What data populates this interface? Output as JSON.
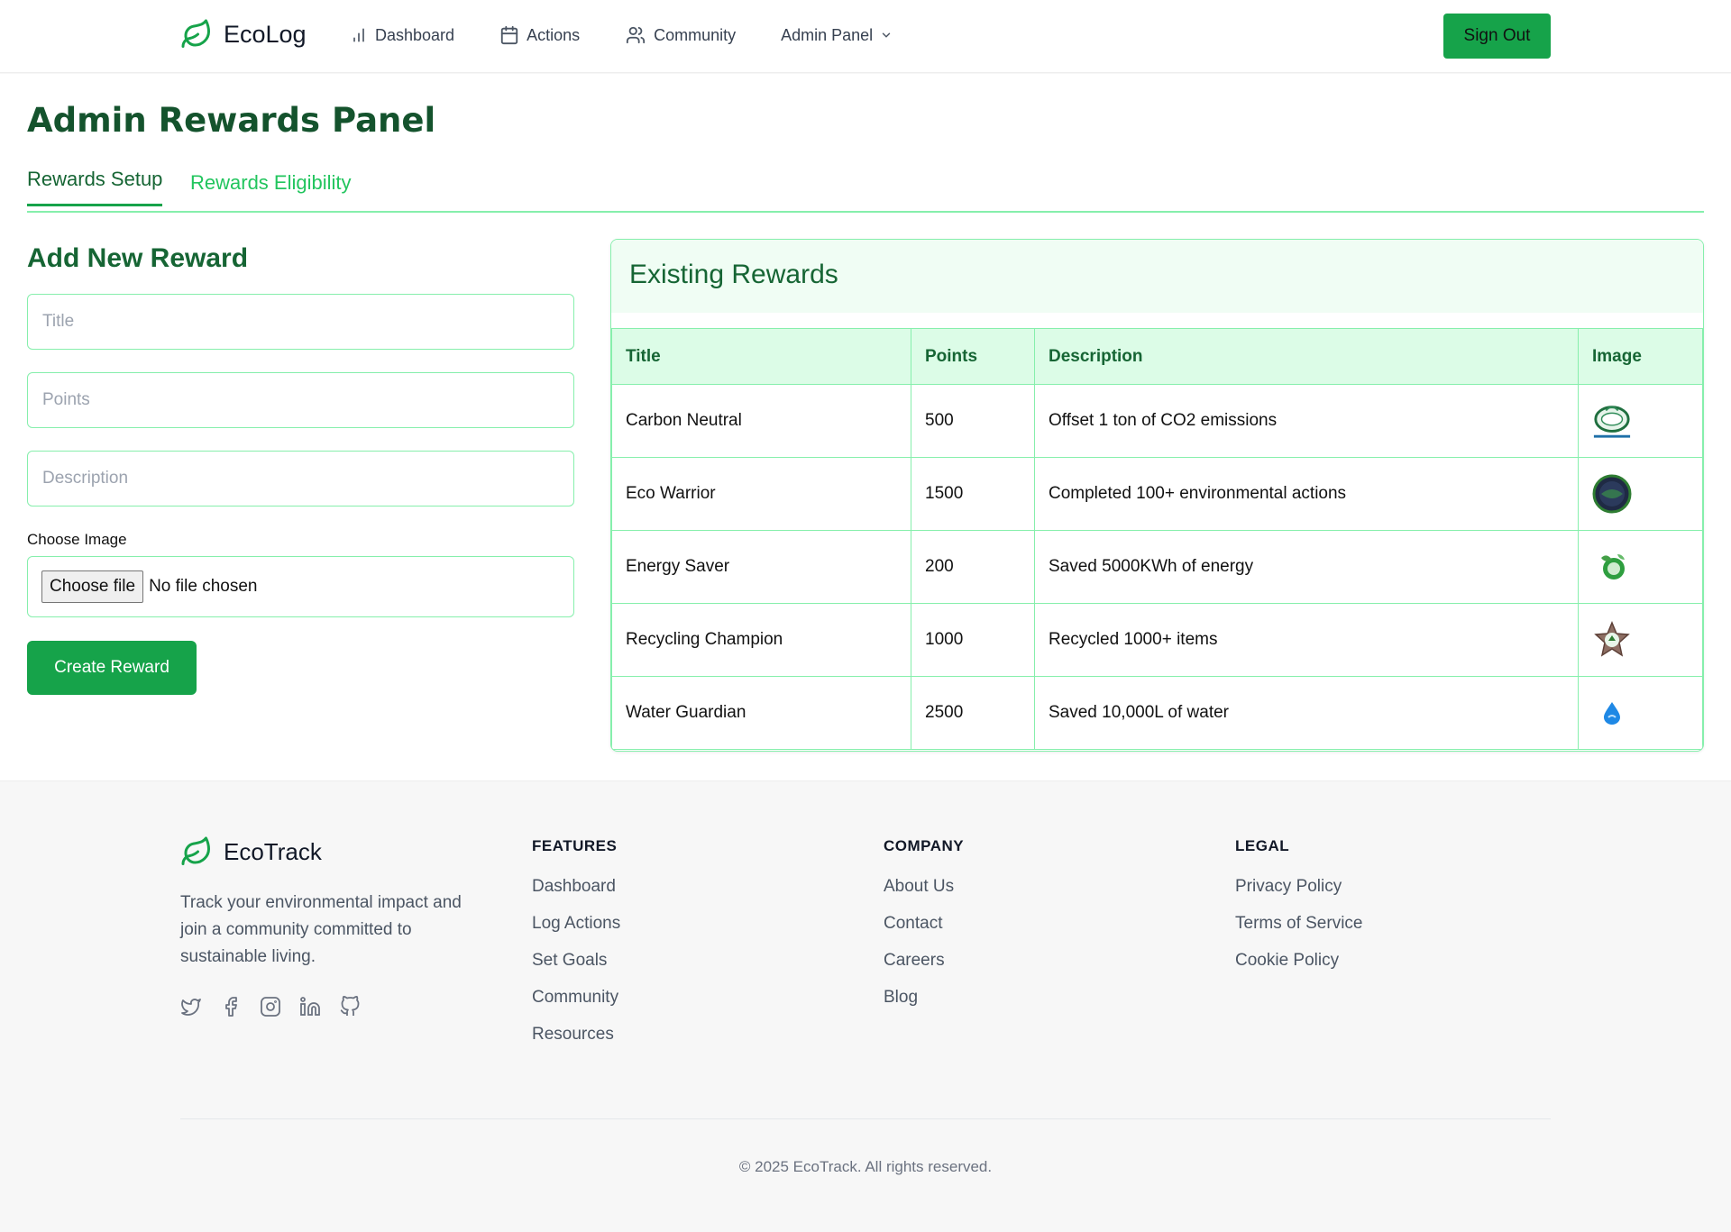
{
  "header": {
    "brand": "EcoLog",
    "nav": [
      {
        "label": "Dashboard",
        "icon": "bar-chart-icon"
      },
      {
        "label": "Actions",
        "icon": "calendar-icon"
      },
      {
        "label": "Community",
        "icon": "users-icon"
      },
      {
        "label": "Admin Panel",
        "icon": "chevron-down-icon"
      }
    ],
    "sign_out": "Sign Out"
  },
  "page": {
    "title": "Admin Rewards Panel",
    "tabs": [
      {
        "label": "Rewards Setup",
        "active": true
      },
      {
        "label": "Rewards Eligibility",
        "active": false
      }
    ]
  },
  "form": {
    "title": "Add New Reward",
    "title_placeholder": "Title",
    "points_placeholder": "Points",
    "description_placeholder": "Description",
    "image_label": "Choose Image",
    "file_button": "Choose file",
    "file_status": "No file chosen",
    "submit": "Create Reward"
  },
  "rewards": {
    "title": "Existing Rewards",
    "columns": [
      "Title",
      "Points",
      "Description",
      "Image"
    ],
    "rows": [
      {
        "title": "Carbon Neutral",
        "points": "500",
        "description": "Offset 1 ton of CO2 emissions",
        "image": "carbon-neutral-badge-icon"
      },
      {
        "title": "Eco Warrior",
        "points": "1500",
        "description": "Completed 100+ environmental actions",
        "image": "eco-warrior-badge-icon"
      },
      {
        "title": "Energy Saver",
        "points": "200",
        "description": "Saved 5000KWh of energy",
        "image": "energy-saver-badge-icon"
      },
      {
        "title": "Recycling Champion",
        "points": "1000",
        "description": "Recycled 1000+ items",
        "image": "recycling-champion-badge-icon"
      },
      {
        "title": "Water Guardian",
        "points": "2500",
        "description": "Saved 10,000L of water",
        "image": "water-guardian-badge-icon"
      }
    ]
  },
  "footer": {
    "brand": "EcoTrack",
    "tagline": "Track your environmental impact and join a community committed to sustainable living.",
    "socials": [
      "twitter-icon",
      "facebook-icon",
      "instagram-icon",
      "linkedin-icon",
      "github-icon"
    ],
    "features": {
      "heading": "FEATURES",
      "links": [
        "Dashboard",
        "Log Actions",
        "Set Goals",
        "Community",
        "Resources"
      ]
    },
    "company": {
      "heading": "COMPANY",
      "links": [
        "About Us",
        "Contact",
        "Careers",
        "Blog"
      ]
    },
    "legal": {
      "heading": "LEGAL",
      "links": [
        "Privacy Policy",
        "Terms of Service",
        "Cookie Policy"
      ]
    },
    "copyright": "© 2025 EcoTrack. All rights reserved."
  },
  "colors": {
    "accent": "#16a34a",
    "dark_green": "#14532d",
    "light_green": "#dcfce7",
    "border_green": "#86efac"
  }
}
